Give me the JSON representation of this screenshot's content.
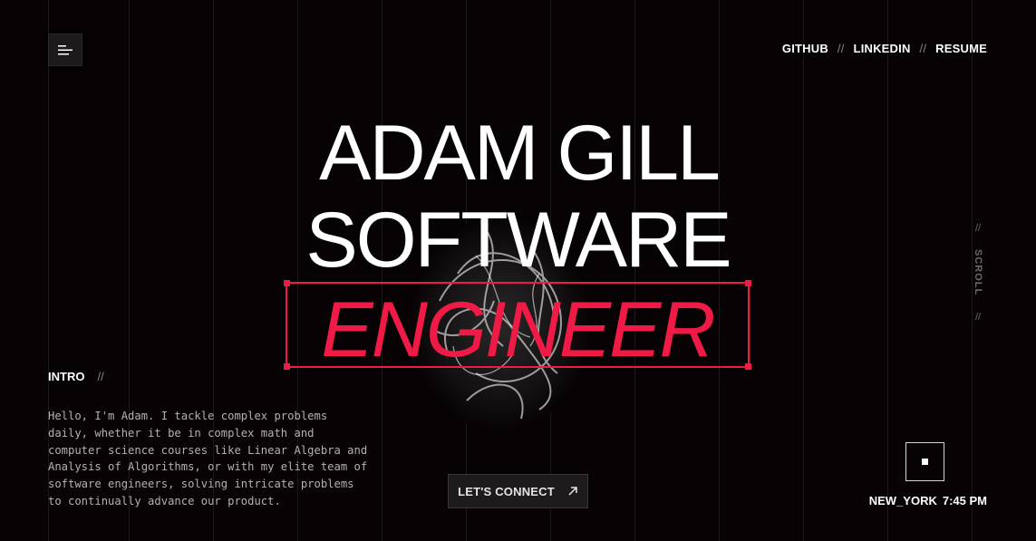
{
  "nav": {
    "github": "GITHUB",
    "linkedin": "LINKEDIN",
    "resume": "RESUME",
    "separator": "//"
  },
  "hero": {
    "line1": "ADAM GILL",
    "line2": "SOFTWARE",
    "line3": "ENGINEER"
  },
  "scroll": {
    "label": "SCROLL",
    "separator": "//"
  },
  "intro": {
    "title": "INTRO",
    "separator": "//",
    "body": "Hello, I'm Adam. I tackle complex problems daily, whether it be in complex math and computer science courses like Linear Algebra and Analysis of Algorithms, or with my elite team of software engineers, solving intricate problems to continually advance our product."
  },
  "cta": {
    "label": "LET'S CONNECT",
    "icon": "arrow-up-right-icon"
  },
  "clock": {
    "location": "NEW_YORK",
    "time": "7:45 PM"
  },
  "colors": {
    "background": "#070304",
    "accent": "#ef1a45",
    "text": "#ffffff",
    "muted": "#b4afb1"
  },
  "icons": {
    "menu": "menu-icon",
    "stop": "stop-icon"
  }
}
